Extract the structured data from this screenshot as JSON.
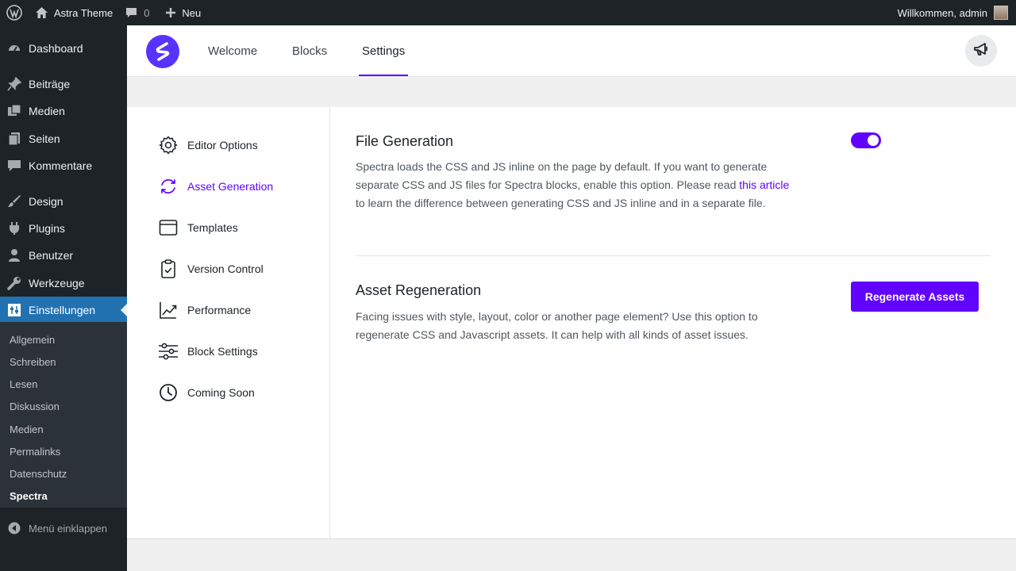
{
  "admin_bar": {
    "site_name": "Astra Theme",
    "comments_count": "0",
    "new_label": "Neu",
    "greeting": "Willkommen, admin"
  },
  "sidebar": {
    "items": [
      {
        "label": "Dashboard",
        "icon": "dashboard-icon"
      },
      {
        "label": "Beiträge",
        "icon": "pin-icon"
      },
      {
        "label": "Medien",
        "icon": "media-icon"
      },
      {
        "label": "Seiten",
        "icon": "pages-icon"
      },
      {
        "label": "Kommentare",
        "icon": "comment-icon"
      },
      {
        "label": "Design",
        "icon": "brush-icon"
      },
      {
        "label": "Plugins",
        "icon": "plugin-icon"
      },
      {
        "label": "Benutzer",
        "icon": "user-icon"
      },
      {
        "label": "Werkzeuge",
        "icon": "wrench-icon"
      },
      {
        "label": "Einstellungen",
        "icon": "settings-icon"
      }
    ],
    "submenu": [
      "Allgemein",
      "Schreiben",
      "Lesen",
      "Diskussion",
      "Medien",
      "Permalinks",
      "Datenschutz",
      "Spectra"
    ],
    "current_submenu": "Spectra",
    "collapse_label": "Menü einklappen"
  },
  "spectra": {
    "tabs": [
      "Welcome",
      "Blocks",
      "Settings"
    ],
    "active_tab": "Settings",
    "accent_color": "#6104ff"
  },
  "settings_nav": {
    "items": [
      {
        "label": "Editor Options",
        "icon": "gear-icon"
      },
      {
        "label": "Asset Generation",
        "icon": "refresh-icon"
      },
      {
        "label": "Templates",
        "icon": "template-icon"
      },
      {
        "label": "Version Control",
        "icon": "clipboard-check-icon"
      },
      {
        "label": "Performance",
        "icon": "trend-icon"
      },
      {
        "label": "Block Settings",
        "icon": "sliders-icon"
      },
      {
        "label": "Coming Soon",
        "icon": "clock-icon"
      }
    ],
    "active": "Asset Generation"
  },
  "file_generation": {
    "title": "File Generation",
    "desc_before": "Spectra loads the CSS and JS inline on the page by default. If you want to generate separate CSS and JS files for Spectra blocks, enable this option. Please read ",
    "link_text": "this article",
    "desc_after": " to learn the difference between generating CSS and JS inline and in a separate file.",
    "enabled": true
  },
  "asset_regeneration": {
    "title": "Asset Regeneration",
    "desc": "Facing issues with style, layout, color or another page element? Use this option to regenerate CSS and Javascript assets. It can help with all kinds of asset issues.",
    "button_label": "Regenerate Assets"
  }
}
